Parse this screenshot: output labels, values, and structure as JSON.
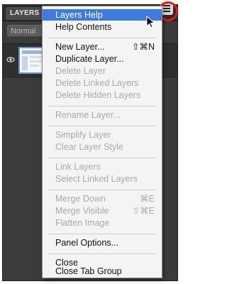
{
  "panel": {
    "tab_label": "LAYERS",
    "tab_close": "✕",
    "blend_mode": "Normal",
    "eye_icon": "eye-icon",
    "menu_button_icon": "panel-menu-icon"
  },
  "menu": {
    "items": [
      {
        "label": "Layers Help",
        "shortcut": "",
        "enabled": true,
        "selected": true
      },
      {
        "label": "Help Contents",
        "shortcut": "",
        "enabled": true
      },
      {
        "label": "New Layer...",
        "shortcut": "⇧⌘N",
        "enabled": true
      },
      {
        "label": "Duplicate Layer...",
        "shortcut": "",
        "enabled": true
      },
      {
        "label": "Delete Layer",
        "shortcut": "",
        "enabled": false
      },
      {
        "label": "Delete Linked Layers",
        "shortcut": "",
        "enabled": false
      },
      {
        "label": "Delete Hidden Layers",
        "shortcut": "",
        "enabled": false
      },
      {
        "label": "Rename Layer...",
        "shortcut": "",
        "enabled": false
      },
      {
        "label": "Simplify Layer",
        "shortcut": "",
        "enabled": false
      },
      {
        "label": "Clear Layer Style",
        "shortcut": "",
        "enabled": false
      },
      {
        "label": "Link Layers",
        "shortcut": "",
        "enabled": false
      },
      {
        "label": "Select Linked Layers",
        "shortcut": "",
        "enabled": false
      },
      {
        "label": "Merge Down",
        "shortcut": "⌘E",
        "enabled": false
      },
      {
        "label": "Merge Visible",
        "shortcut": "⇧⌘E",
        "enabled": false
      },
      {
        "label": "Flatten Image",
        "shortcut": "",
        "enabled": false
      },
      {
        "label": "Panel Options...",
        "shortcut": "",
        "enabled": true
      },
      {
        "label": "Close",
        "shortcut": "",
        "enabled": true
      },
      {
        "label": "Close Tab Group",
        "shortcut": "",
        "enabled": true
      }
    ]
  },
  "colors": {
    "selection": "#3d7be0",
    "highlight_ring": "#e11b1b",
    "disabled_text": "#a9a9a9"
  }
}
